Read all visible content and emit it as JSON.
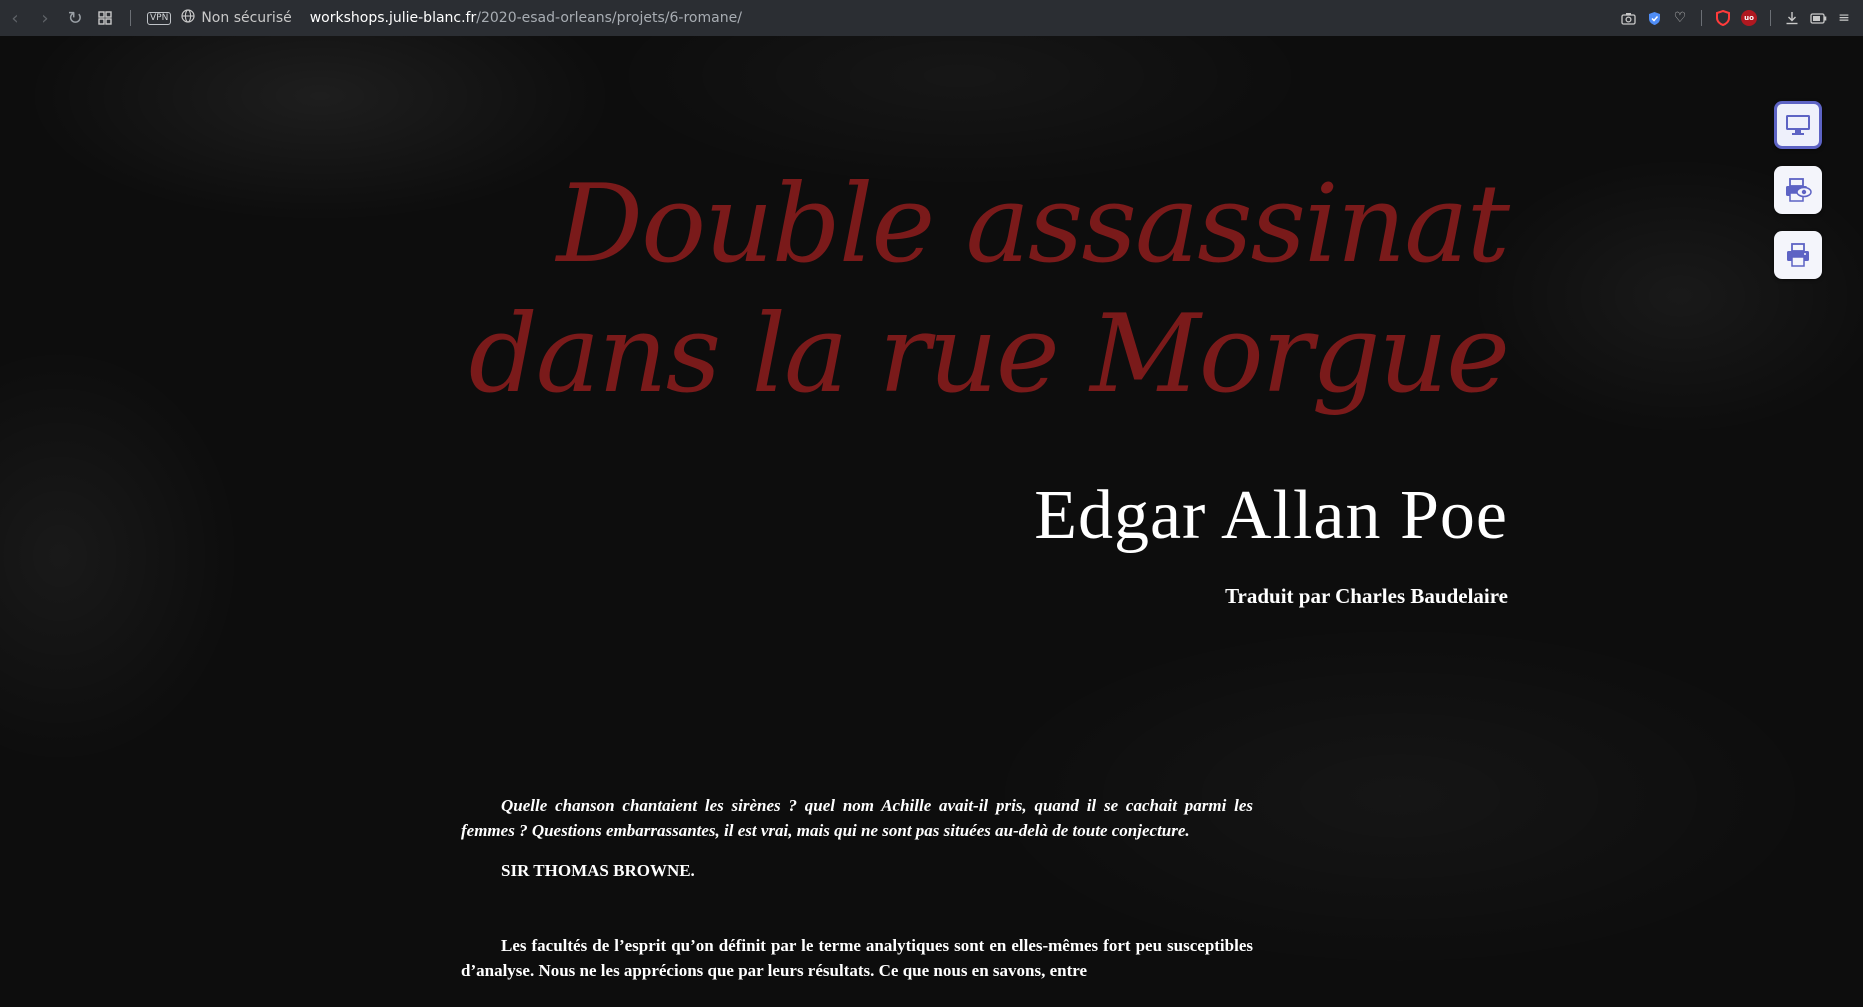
{
  "browser": {
    "vpn_label": "VPN",
    "security_label": "Non sécurisé",
    "url_host": "workshops.julie-blanc.fr",
    "url_path": "/2020-esad-orleans/projets/6-romane/"
  },
  "book": {
    "title_line1": "Double assassinat",
    "title_line2": "dans la rue Morgue",
    "author": "Edgar Allan Poe",
    "translator": "Traduit par Charles Baudelaire",
    "epigraph": "Quelle chanson chantaient les sirènes ? quel nom Achille avait-il pris, quand il se cachait parmi les femmes ? Questions embarrassantes, il est vrai, mais qui ne sont pas situées  au-delà de toute conjecture.",
    "epigraph_author": "SIR THOMAS BROWNE.",
    "first_paragraph": "Les facultés de l’esprit qu’on définit par le terme analytiques sont en elles-mêmes fort peu susceptibles d’analyse. Nous ne les apprécions que par leurs résultats. Ce que nous en savons, entre"
  },
  "view_controls": {
    "active": "screen"
  },
  "colors": {
    "title": "#7a1a1a",
    "toolbar": "#2b2e33",
    "accent": "#5d63c4"
  }
}
